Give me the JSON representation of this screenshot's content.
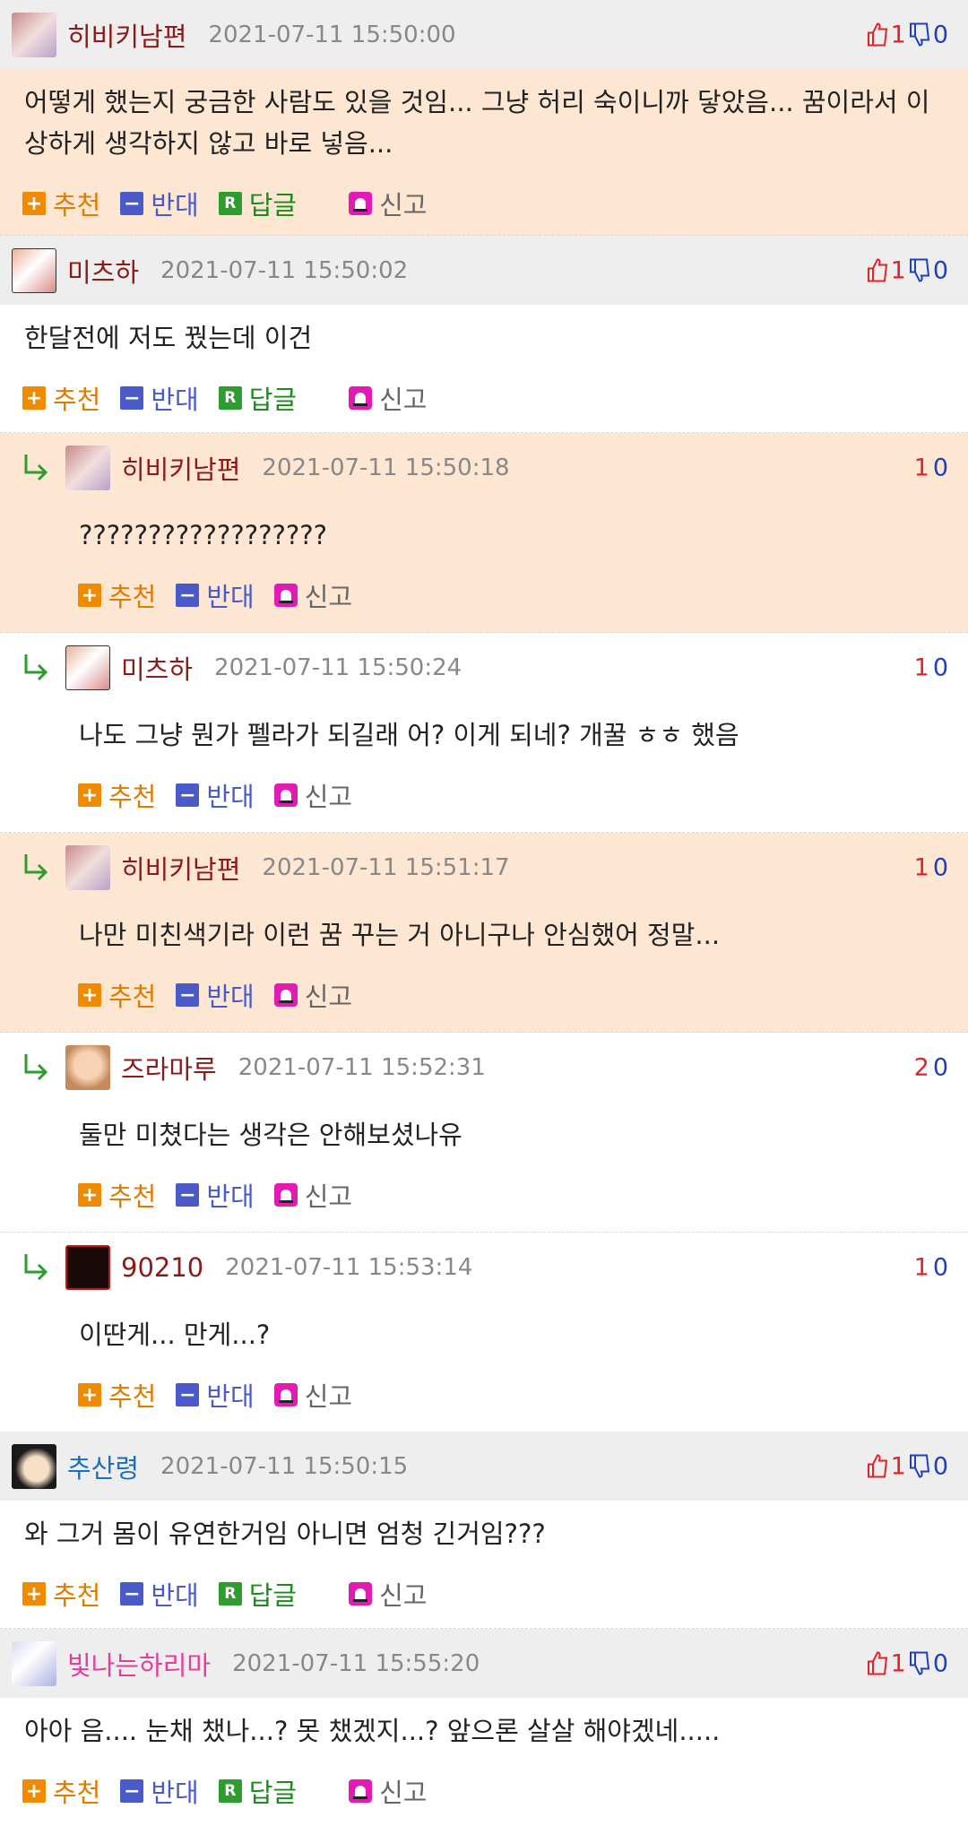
{
  "labels": {
    "recommend": "추천",
    "oppose": "반대",
    "reply": "답글",
    "report": "신고"
  },
  "colors": {
    "highlight": "#fde6d2",
    "header": "#eeeeee",
    "up": "#e3232a",
    "down": "#1f3fbf",
    "nick": "#8b1a1a"
  },
  "comments": [
    {
      "nick": "히비키남편",
      "date": "2021-07-11 15:50:00",
      "up": "1",
      "down": "0",
      "text": "어떻게 했는지 궁금한 사람도 있을 것임... 그냥 허리 숙이니까 닿았음... 꿈이라서 이상하게 생각하지 않고 바로 넣음..."
    },
    {
      "nick": "미츠하",
      "date": "2021-07-11 15:50:02",
      "up": "1",
      "down": "0",
      "text": "한달전에 저도 꿨는데 이건"
    },
    {
      "nick": "히비키남편",
      "date": "2021-07-11 15:50:18",
      "up": "1",
      "down": "0",
      "text": "??????????????????"
    },
    {
      "nick": "미츠하",
      "date": "2021-07-11 15:50:24",
      "up": "1",
      "down": "0",
      "text": "나도 그냥 뭔가 펠라가 되길래 어? 이게 되네? 개꿀 ㅎㅎ 했음"
    },
    {
      "nick": "히비키남편",
      "date": "2021-07-11 15:51:17",
      "up": "1",
      "down": "0",
      "text": "나만 미친색기라 이런 꿈 꾸는 거 아니구나 안심했어 정말..."
    },
    {
      "nick": "즈라마루",
      "date": "2021-07-11 15:52:31",
      "up": "2",
      "down": "0",
      "text": "둘만 미쳤다는 생각은 안해보셨나유"
    },
    {
      "nick": "90210",
      "date": "2021-07-11 15:53:14",
      "up": "1",
      "down": "0",
      "text": "이딴게... 만게...?"
    },
    {
      "nick": "추산령",
      "date": "2021-07-11 15:50:15",
      "up": "1",
      "down": "0",
      "text": "와 그거 몸이 유연한거임 아니면 엄청 긴거임???"
    },
    {
      "nick": "빛나는하리마",
      "date": "2021-07-11 15:55:20",
      "up": "1",
      "down": "0",
      "text": "아아 음.... 눈채 챘나...? 못 챘겠지...? 앞으론 살살 해야겠네....."
    }
  ]
}
